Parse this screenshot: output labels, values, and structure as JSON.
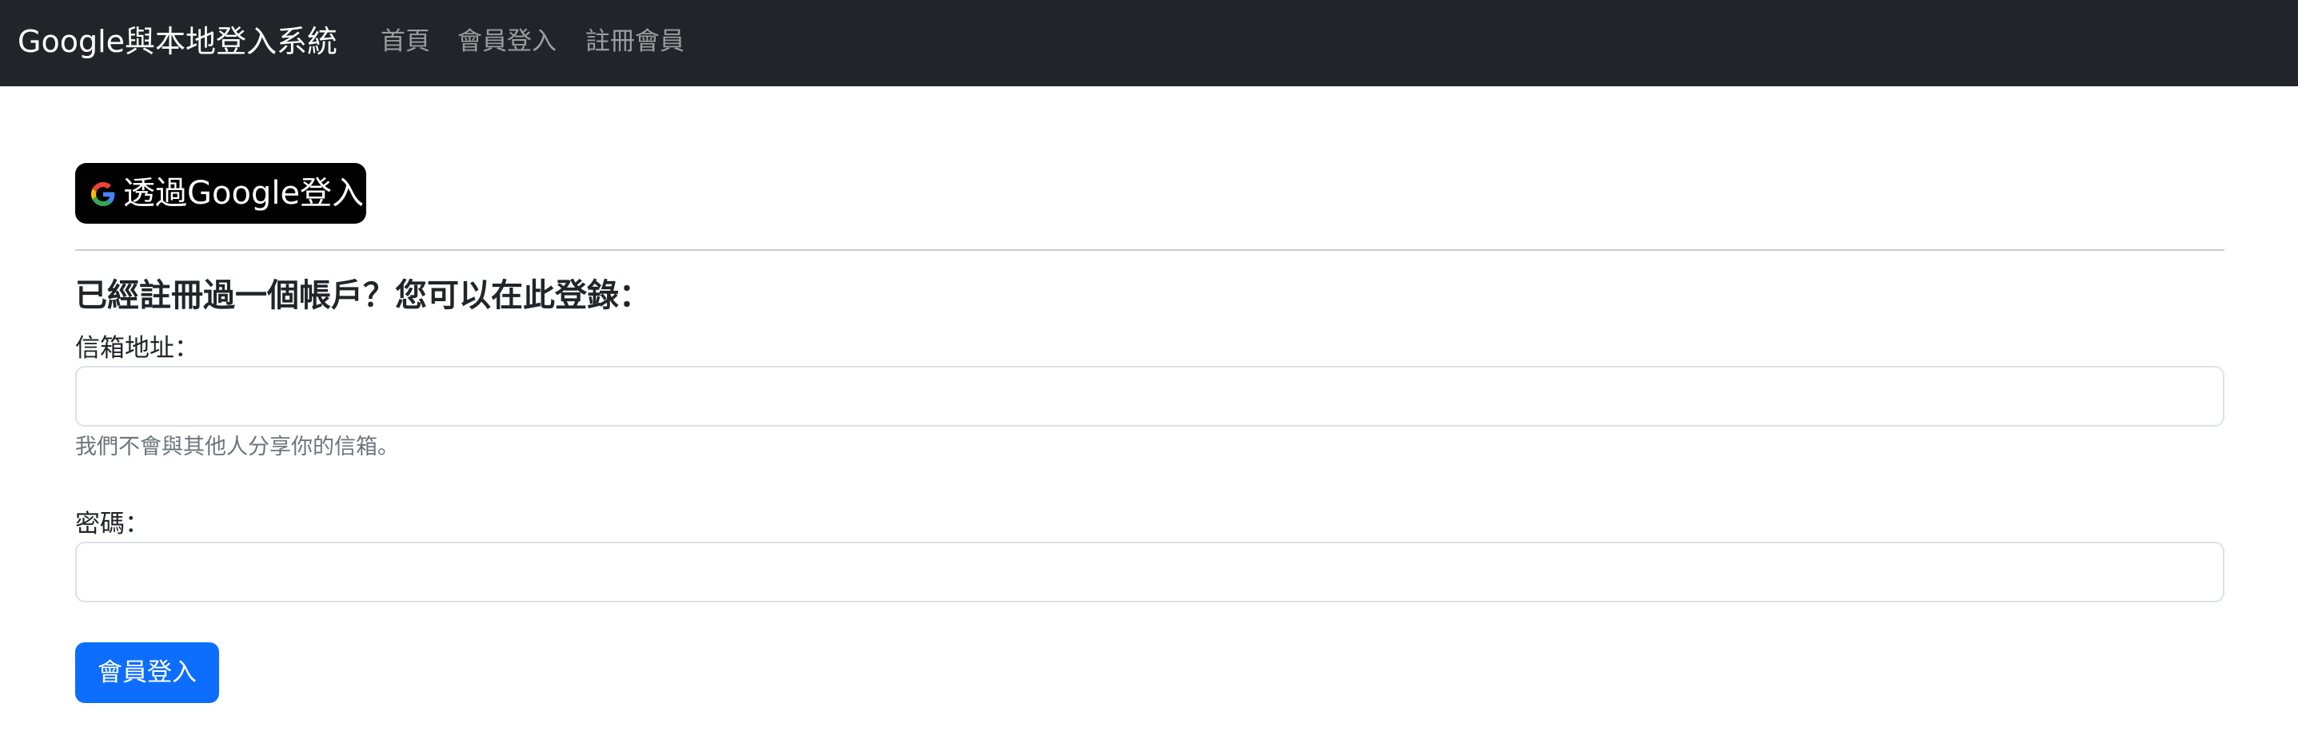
{
  "navbar": {
    "brand": "Google與本地登入系統",
    "links": [
      {
        "label": "首頁"
      },
      {
        "label": "會員登入"
      },
      {
        "label": "註冊會員"
      }
    ],
    "background_color": "#212529"
  },
  "google_login": {
    "label": "透過Google登入",
    "icon": "google-g-icon",
    "background_color": "#000000"
  },
  "login_form": {
    "heading": "已經註冊過一個帳戶？您可以在此登錄：",
    "email_label": "信箱地址：",
    "email_value": "",
    "email_help": "我們不會與其他人分享你的信箱。",
    "password_label": "密碼：",
    "password_value": "",
    "submit_label": "會員登入",
    "submit_color": "#0d6efd"
  }
}
